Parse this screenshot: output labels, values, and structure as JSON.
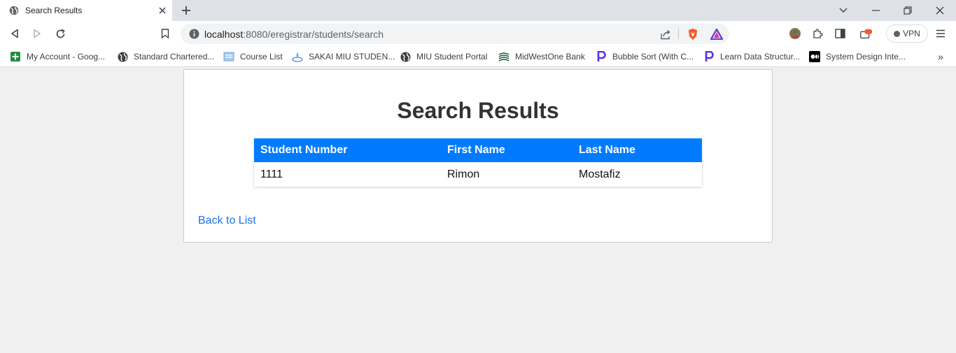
{
  "browser": {
    "tab_title": "Search Results",
    "url_host": "localhost",
    "url_path": ":8080/eregistrar/students/search",
    "vpn_label": "VPN"
  },
  "bookmarks": [
    {
      "label": "My Account - Goog...",
      "icon": "google-sheets-icon"
    },
    {
      "label": "Standard Chartered...",
      "icon": "globe-icon"
    },
    {
      "label": "Course List",
      "icon": "page-icon"
    },
    {
      "label": "SAKAI MIU STUDEN...",
      "icon": "sakai-icon"
    },
    {
      "label": "MIU Student Portal",
      "icon": "globe-icon"
    },
    {
      "label": "MidWestOne Bank",
      "icon": "bank-icon"
    },
    {
      "label": "Bubble Sort (With C...",
      "icon": "programiz-icon"
    },
    {
      "label": "Learn Data Structur...",
      "icon": "programiz-icon"
    },
    {
      "label": "System Design Inte...",
      "icon": "medium-icon"
    }
  ],
  "page": {
    "title": "Search Results",
    "table": {
      "headers": [
        "Student Number",
        "First Name",
        "Last Name"
      ],
      "rows": [
        [
          "1111",
          "Rimon",
          "Mostafiz"
        ]
      ]
    },
    "back_link": "Back to List"
  },
  "colors": {
    "header_bg": "#007bff",
    "link": "#1a73e8"
  }
}
